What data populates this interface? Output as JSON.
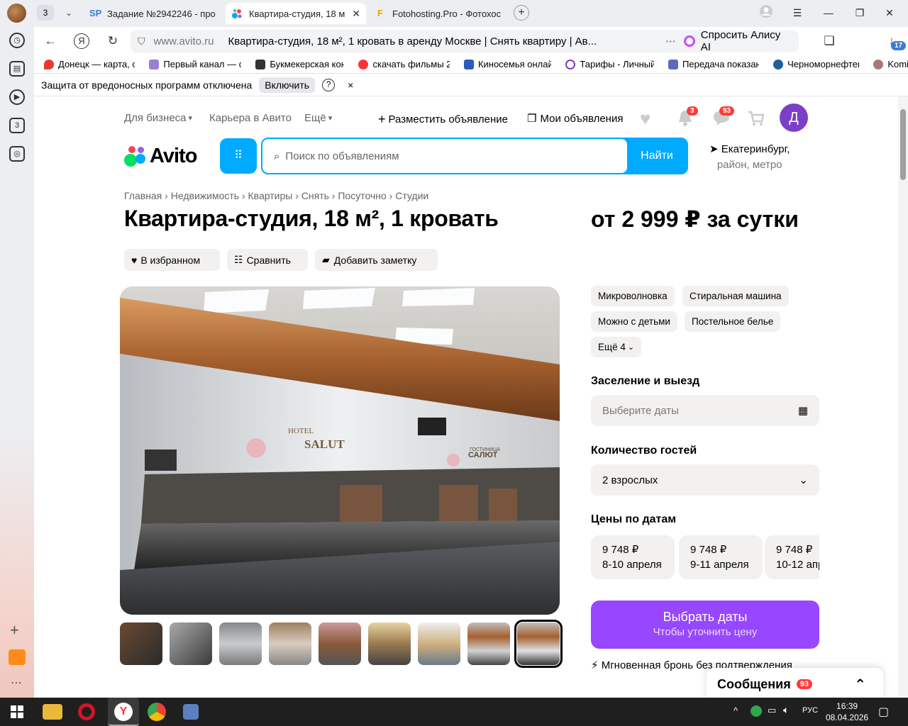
{
  "browser": {
    "tab_count": "3",
    "tabs": [
      {
        "label": "Задание №2942246 - про",
        "icon": "SP"
      },
      {
        "label": "Квартира-студия, 18 м",
        "icon": "avito-dots"
      },
      {
        "label": "Fotohosting.Pro - Фотохос",
        "icon": "F"
      }
    ],
    "address": {
      "host": "www.avito.ru",
      "title": "Квартира-студия, 18 м², 1 кровать в аренду Москве | Снять квартиру | Ав..."
    },
    "alice_label": "Спросить Алису AI",
    "downloads_badge": "17",
    "bookmarks": [
      "Донецк — карта, с",
      "Первый канал — с",
      "Букмекерская кон",
      "скачать фильмы 2",
      "Киносемья онлай",
      "Тарифы - Личный",
      "Передача показан",
      "Черноморнефтег",
      "Komi"
    ],
    "protection": {
      "text": "Защита от вредоносных программ отключена",
      "button": "Включить",
      "help": "?",
      "close": "×"
    },
    "sidebar_badge": "3"
  },
  "header": {
    "business": "Для бизнеса",
    "career": "Карьера в Авито",
    "more": "Ещё",
    "post_ad": "Разместить объявление",
    "my_ads": "Мои объявления",
    "notif_count": "3",
    "msg_count": "93",
    "avatar_letter": "Д",
    "logo": "Avito",
    "search_placeholder": "Поиск по объявлениям",
    "search_button": "Найти",
    "city": "Екатеринбург,",
    "city_sub": "район, метро"
  },
  "breadcrumbs": [
    "Главная",
    "Недвижимость",
    "Квартиры",
    "Снять",
    "Посуточно",
    "Студии"
  ],
  "listing": {
    "title": "Квартира-студия, 18 м², 1 кровать",
    "price": "от 2 999 ₽ за сутки",
    "actions": [
      "В избранном",
      "Сравнить",
      "Добавить заметку"
    ],
    "amenities": [
      "Микроволновка",
      "Стиральная машина",
      "Можно с детьми",
      "Постельное белье"
    ],
    "more_amenities": "Ещё 4",
    "checkin_label": "Заселение и выезд",
    "dates_placeholder": "Выберите даты",
    "guests_label": "Количество гостей",
    "guests_value": "2 взрослых",
    "prices_label": "Цены по датам",
    "price_dates": [
      {
        "price": "9 748 ₽",
        "dates": "8-10 апреля"
      },
      {
        "price": "9 748 ₽",
        "dates": "9-11 апреля"
      },
      {
        "price": "9 748 ₽",
        "dates": "10-12 апр"
      }
    ],
    "cta_main": "Выбрать даты",
    "cta_sub": "Чтобы уточнить цену",
    "instant": "Мгновенная бронь без подтверждения",
    "photo_signs": [
      "HOTEL",
      "SALUT",
      "ГОСТИНИЦА",
      "САЛЮТ"
    ]
  },
  "messages": {
    "label": "Сообщения",
    "count": "93"
  },
  "taskbar": {
    "lang": "РУС",
    "time": "16:39",
    "date": "08.04.2026"
  }
}
